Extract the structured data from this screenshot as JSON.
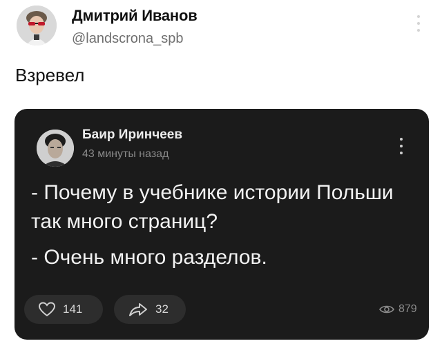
{
  "author": {
    "name": "Дмитрий Иванов",
    "handle": "@landscrona_spb"
  },
  "tweet": {
    "text": "Взревел"
  },
  "embedded_post": {
    "author_name": "Баир Иринчеев",
    "time": "43 минуты назад",
    "lines": [
      "- Почему в учебнике истории Польши так много страниц?",
      "- Очень много разделов."
    ],
    "likes": "141",
    "shares": "32",
    "views": "879"
  },
  "icons": {
    "more": "vertical-dots-icon",
    "like": "heart-icon",
    "share": "share-arrow-icon",
    "views": "eye-icon"
  },
  "colors": {
    "card_bg": "#1b1b1b",
    "page_bg": "#ffffff",
    "button_bg": "#2d2d2d"
  }
}
